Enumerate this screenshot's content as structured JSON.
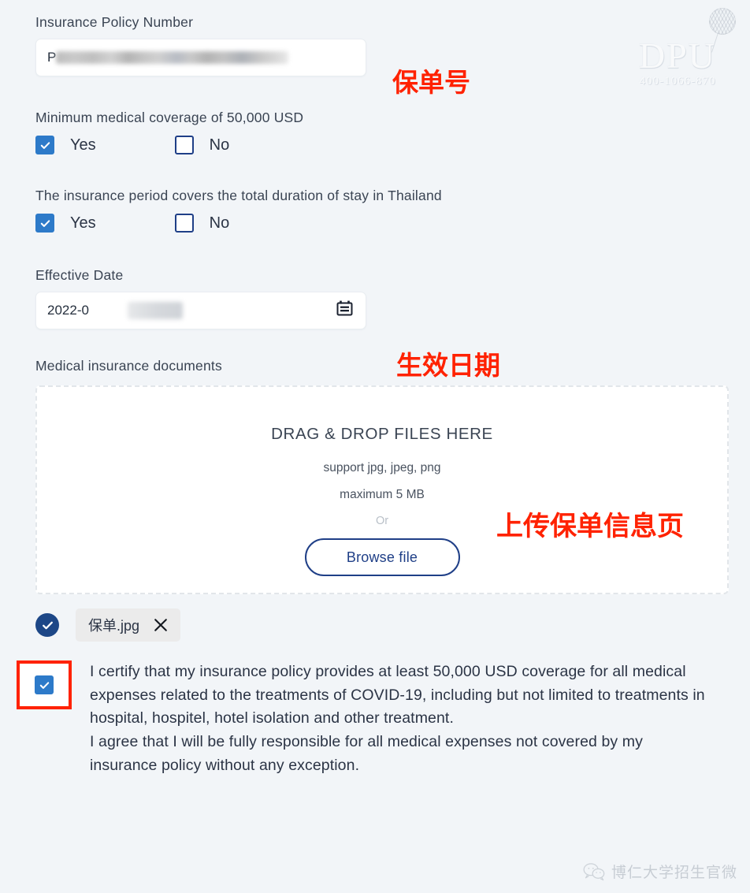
{
  "form": {
    "policy_number": {
      "label": "Insurance Policy Number",
      "value": "P",
      "redacted": true
    },
    "coverage_question": {
      "text": "Minimum medical coverage of 50,000 USD",
      "options": [
        {
          "label": "Yes",
          "checked": true
        },
        {
          "label": "No",
          "checked": false
        }
      ]
    },
    "period_question": {
      "text": "The insurance period covers the total duration of stay in Thailand",
      "options": [
        {
          "label": "Yes",
          "checked": true
        },
        {
          "label": "No",
          "checked": false
        }
      ]
    },
    "effective_date": {
      "label": "Effective Date",
      "value": "2022-0",
      "redacted": true,
      "icon": "calendar-icon"
    },
    "documents": {
      "label": "Medical insurance documents",
      "dropzone_title": "DRAG & DROP FILES HERE",
      "supported_formats": "support jpg, jpeg, png",
      "max_size": "maximum 5 MB",
      "or_text": "Or",
      "browse_button": "Browse file"
    },
    "uploaded_file": {
      "name": "保单.jpg",
      "status_icon": "check-circle-icon",
      "remove_icon": "close-icon"
    },
    "certification": {
      "checked": true,
      "highlighted": true,
      "paragraph_1": "I certify that my insurance policy provides at least 50,000 USD coverage for all medical expenses related to the treatments of COVID-19, including but not limited to treatments in hospital, hospitel, hotel isolation and other treatment.",
      "paragraph_2": "I agree that I will be fully responsible for all medical expenses not covered by my insurance policy without any exception."
    }
  },
  "annotations": [
    {
      "text": "保单号",
      "target": "policy-number"
    },
    {
      "text": "生效日期",
      "target": "effective-date"
    },
    {
      "text": "上传保单信息页",
      "target": "documents"
    }
  ],
  "watermarks": {
    "dpu": {
      "letters": "DPU",
      "phone": "400-1066-870"
    },
    "wechat": {
      "icon": "wechat-icon",
      "label": "博仁大学招生官微"
    }
  },
  "colors": {
    "page_background": "#f2f5f8",
    "checkbox_checked": "#2d7ac9",
    "checkbox_border": "#1f3f87",
    "button_border": "#1f3f87",
    "annotation_red": "#ff2200",
    "file_badge": "#1d4787",
    "text": "#2b3445"
  }
}
